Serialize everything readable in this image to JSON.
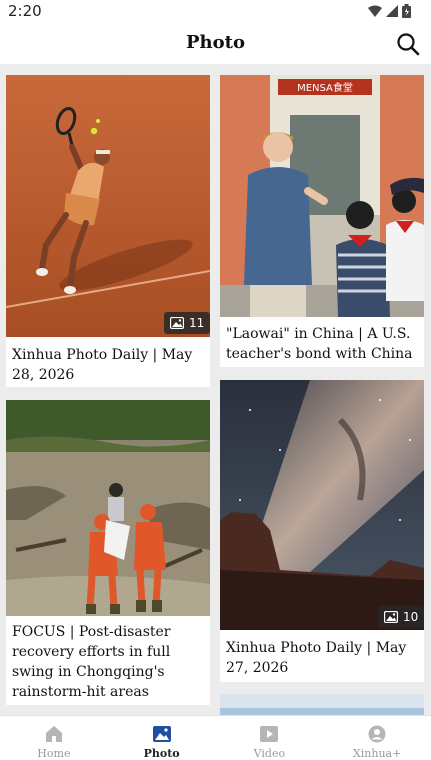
{
  "status_bar": {
    "time": "2:20"
  },
  "header": {
    "title": "Photo"
  },
  "cards": [
    {
      "caption": "Xinhua Photo Daily | May 28, 2026",
      "photo_count": "11",
      "image": "tennis-player-photo"
    },
    {
      "caption": "\"Laowai\" in China | A U.S. teacher's bond with China",
      "image": "teacher-students-photo",
      "sign_text": "MENSA食堂"
    },
    {
      "caption": "FOCUS | Post-disaster recovery efforts in full swing in Chongqing's rainstorm-hit areas",
      "image": "rescue-workers-photo"
    },
    {
      "caption": "Xinhua Photo Daily | May 27, 2026",
      "photo_count": "10",
      "image": "milky-way-photo"
    }
  ],
  "tabs": [
    {
      "label": "Home",
      "icon": "home-icon",
      "active": false
    },
    {
      "label": "Photo",
      "icon": "photo-icon",
      "active": true
    },
    {
      "label": "Video",
      "icon": "video-icon",
      "active": false
    },
    {
      "label": "Xinhua+",
      "icon": "profile-icon",
      "active": false
    }
  ],
  "colors": {
    "accent": "#1f4fa0",
    "inactive": "#9a9a9a",
    "background": "#ececec"
  }
}
